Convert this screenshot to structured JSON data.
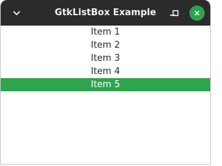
{
  "window": {
    "title": "GtkListBox Example"
  },
  "titlebar": {
    "menu_icon": "chevron-down-icon",
    "minimize_icon": "minimize-icon",
    "maximize_icon": "maximize-icon",
    "close_icon": "close-icon"
  },
  "colors": {
    "titlebar_bg": "#2b2b2b",
    "selection_bg": "#2ea44f",
    "close_button_bg": "#2ea44f"
  },
  "listbox": {
    "items": [
      {
        "label": "Item 1",
        "selected": false
      },
      {
        "label": "Item 2",
        "selected": false
      },
      {
        "label": "Item 3",
        "selected": false
      },
      {
        "label": "Item 4",
        "selected": false
      },
      {
        "label": "Item 5",
        "selected": true
      }
    ]
  }
}
